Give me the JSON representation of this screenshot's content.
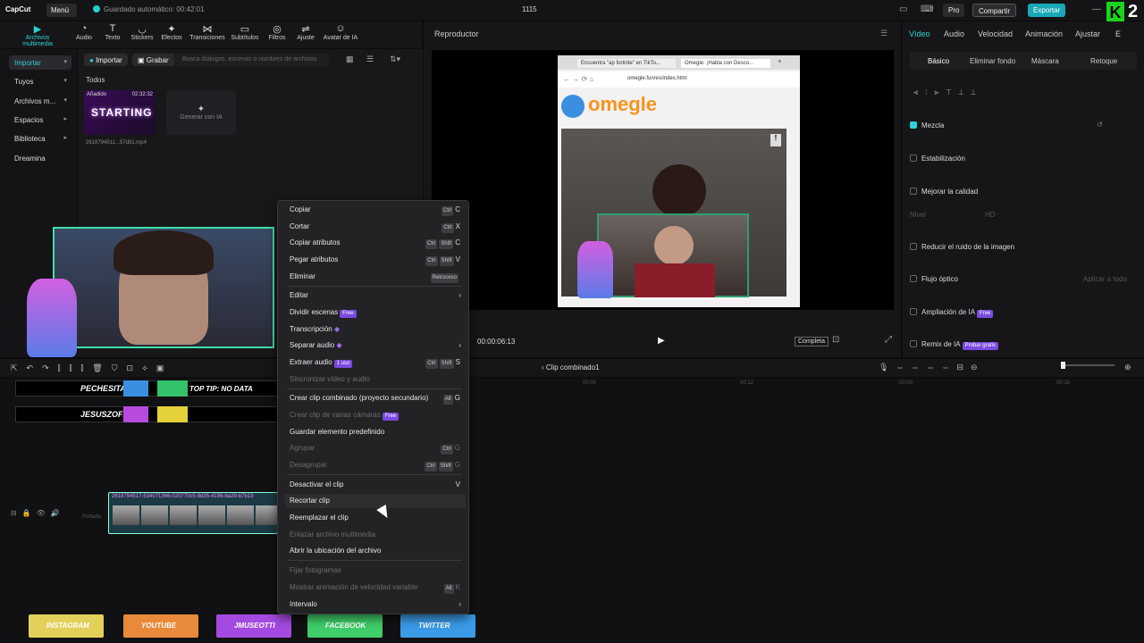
{
  "topbar": {
    "logo": "CapCut",
    "menu": "Menú",
    "autosave": "Guardado automático: 00:42:01",
    "project": "1115",
    "pro": "Pro",
    "share": "Compartir",
    "export": "Exportar",
    "badge_k": "K",
    "badge_2": "2"
  },
  "tools": [
    {
      "label": "Archivos multimedia",
      "icon": "▶"
    },
    {
      "label": "Audio",
      "icon": "◔"
    },
    {
      "label": "Texto",
      "icon": "T"
    },
    {
      "label": "Stickers",
      "icon": "◡"
    },
    {
      "label": "Efectos",
      "icon": "✦"
    },
    {
      "label": "Transiciones",
      "icon": "⋈"
    },
    {
      "label": "Subtítulos",
      "icon": "▭"
    },
    {
      "label": "Filtros",
      "icon": "◎"
    },
    {
      "label": "Ajuste",
      "icon": "⇌"
    },
    {
      "label": "Avatar de IA",
      "icon": "☺"
    }
  ],
  "leftnav": {
    "import": "Importar",
    "yours": "Tuyos",
    "files": "Archivos m...",
    "spaces": "Espacios",
    "library": "Biblioteca",
    "dreamina": "Dreamina"
  },
  "media": {
    "import_btn": "Importar",
    "record_btn": "Grabar",
    "search_placeholder": "Busca diálogos, escenas o nombres de archivos",
    "all": "Todos",
    "thumb_added": "Añadido",
    "thumb_duration": "02:32:32",
    "thumb_text": "STARTING",
    "thumb_filename": "2618794511...57d81.mp4",
    "gen_ai": "Generar con IA"
  },
  "player": {
    "title": "Reproductor",
    "tab1": "Encuentra \"ap fortnite\" en TikTo...",
    "tab2": "Omegle: ¡Habla con Desco...",
    "url": "omegle.fun/es/index.html",
    "brand": "omegle",
    "time": "00:00:06:13",
    "complete": "Completa"
  },
  "right": {
    "tabs": [
      "Vídeo",
      "Audio",
      "Velocidad",
      "Animación",
      "Ajustar",
      "E"
    ],
    "subtabs": [
      "Básico",
      "Eliminar fondo",
      "Máscara",
      "Retoque"
    ],
    "mix": "Mezcla",
    "stabilize": "Estabilización",
    "quality": "Mejorar la calidad",
    "level": "Nivel",
    "hd": "HD",
    "noise": "Reducir el ruido de la imagen",
    "optical": "Flujo óptico",
    "apply_all": "Aplicar a todo",
    "ai_expand": "Ampliación de IA",
    "free": "Free",
    "ai_remix": "Remix de IA",
    "try_free": "Probar gratis"
  },
  "timeline": {
    "combined": "Clip combinado1",
    "ticks": [
      "00:00",
      "00:12",
      "00:00",
      "00:18"
    ],
    "cover": "Portada",
    "clip_title": "2618794517-534071366-020770c5-9d35-4196-ba29-b7b13"
  },
  "overlays": {
    "name1": "PECHESITA",
    "name2": "JESUSZOFF",
    "tip": "TOP TIP: NO DATA"
  },
  "context_menu": {
    "copy": "Copiar",
    "cut": "Cortar",
    "copy_attr": "Copiar atributos",
    "paste_attr": "Pegar atributos",
    "delete": "Eliminar",
    "edit": "Editar",
    "split_scenes": "Dividir escenas",
    "transcription": "Transcripción",
    "separate_audio": "Separar audio",
    "extract_audio": "Extraer audio",
    "sync_video_audio": "Sincronizar vídeo y audio",
    "create_combined": "Crear clip combinado (proyecto secundario)",
    "create_multicam": "Crear clip de varias cámaras",
    "save_preset": "Guardar elemento predefinido",
    "group": "Agrupar",
    "ungroup": "Desagrupar",
    "disable_clip": "Desactivar el clip",
    "trim_clip": "Recortar clip",
    "replace_clip": "Reemplazar el clip",
    "link_media": "Enlazar archivo multimedia",
    "open_location": "Abrir la ubicación del archivo",
    "set_cover": "Fijar fotogramas",
    "show_speed_anim": "Mostrar animación de velocidad variable",
    "interval": "Intervalo",
    "badge_free": "Free",
    "badge_uses": "1 uso",
    "key_ctrl": "Ctrl",
    "key_shift": "Shift",
    "key_alt": "Alt",
    "k_c": "C",
    "k_x": "X",
    "k_v": "V",
    "k_s": "S",
    "k_g": "G",
    "k_delete": "Retroceso",
    "k_k": "K"
  },
  "socials": [
    "INSTAGRAM",
    "YOUTUBE",
    "JMUSEOTTI",
    "FACEBOOK",
    "TWITTER"
  ],
  "colors": {
    "accent": "#2bd3d3",
    "export": "#1aa7b8",
    "premium": "#7b4ae0",
    "brand_orange": "#f7931e"
  }
}
